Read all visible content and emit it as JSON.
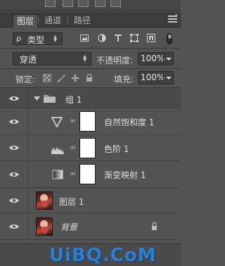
{
  "tabs": [
    {
      "label": "图层",
      "active": true
    },
    {
      "label": "通道",
      "active": false
    },
    {
      "label": "路径",
      "active": false
    }
  ],
  "filter": {
    "kind_label": "类型",
    "search_glyph": "ρ"
  },
  "blend_mode": "穿透",
  "opacity": {
    "label": "不透明度:",
    "value": "100%"
  },
  "lock": {
    "label": "锁定:"
  },
  "fill": {
    "label": "填充:",
    "value": "100%"
  },
  "layers": [
    {
      "name": "组 1",
      "type": "group"
    },
    {
      "name": "自然饱和度 1",
      "type": "adjustment",
      "icon": "vibrance-icon"
    },
    {
      "name": "色阶 1",
      "type": "adjustment",
      "icon": "levels-icon"
    },
    {
      "name": "渐变映射 1",
      "type": "adjustment",
      "icon": "gradient-map-icon"
    },
    {
      "name": "图层 1",
      "type": "pixel"
    },
    {
      "name": "背景",
      "type": "background",
      "locked": true
    }
  ],
  "watermark": "UiBQ.CoM",
  "colors": {
    "panel": "#535353",
    "tabbar": "#3c3c3c",
    "watermark": "#2c7fd0"
  }
}
